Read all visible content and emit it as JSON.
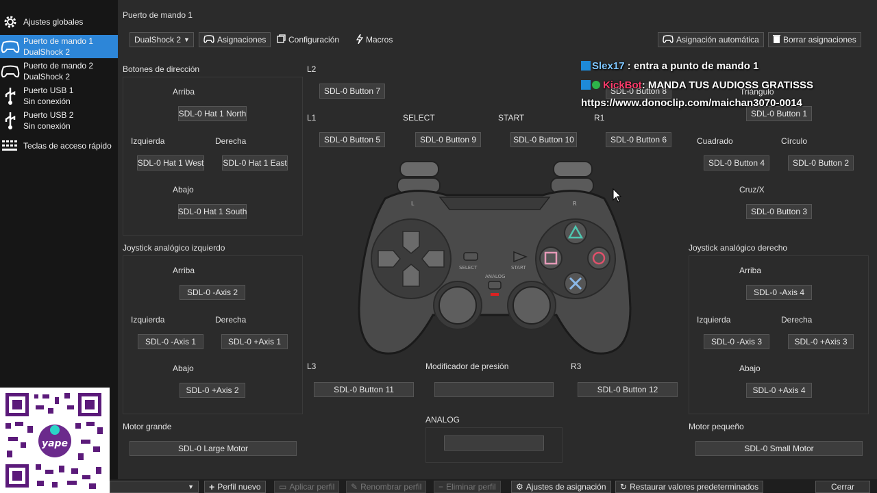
{
  "sidebar": {
    "items": [
      {
        "icon": "gear-icon",
        "line1": "Ajustes globales",
        "line2": ""
      },
      {
        "icon": "gamepad-icon",
        "line1": "Puerto de mando 1",
        "line2": "DualShock 2"
      },
      {
        "icon": "gamepad-icon",
        "line1": "Puerto de mando 2",
        "line2": "DualShock 2"
      },
      {
        "icon": "usb-icon",
        "line1": "Puerto USB 1",
        "line2": "Sin conexión"
      },
      {
        "icon": "usb-icon",
        "line1": "Puerto USB 2",
        "line2": "Sin conexión"
      },
      {
        "icon": "keyboard-icon",
        "line1": "Teclas de acceso rápido",
        "line2": ""
      }
    ]
  },
  "header": {
    "title": "Puerto de mando 1",
    "controller_type": "DualShock 2",
    "tab_bindings": "Asignaciones",
    "tab_settings": "Configuración",
    "tab_macros": "Macros",
    "auto_mapping": "Asignación automática",
    "clear_mapping": "Borrar asignaciones"
  },
  "dpad": {
    "section": "Botones de dirección",
    "up_label": "Arriba",
    "up_value": "SDL-0 Hat 1 North",
    "left_label": "Izquierda",
    "left_value": "SDL-0 Hat 1 West",
    "right_label": "Derecha",
    "right_value": "SDL-0 Hat 1 East",
    "down_label": "Abajo",
    "down_value": "SDL-0 Hat 1 South"
  },
  "left_stick": {
    "section": "Joystick analógico izquierdo",
    "up_label": "Arriba",
    "up_value": "SDL-0 -Axis 2",
    "left_label": "Izquierda",
    "left_value": "SDL-0 -Axis 1",
    "right_label": "Derecha",
    "right_value": "SDL-0 +Axis 1",
    "down_label": "Abajo",
    "down_value": "SDL-0 +Axis 2"
  },
  "center": {
    "l2_label": "L2",
    "l2_value": "SDL-0 Button 7",
    "l1_label": "L1",
    "l1_value": "SDL-0 Button 5",
    "select_label": "SELECT",
    "select_value": "SDL-0 Button 9",
    "start_label": "START",
    "start_value": "SDL-0 Button 10",
    "r1_label": "R1",
    "r1_value": "SDL-0 Button 6",
    "l3_label": "L3",
    "l3_value": "SDL-0 Button 11",
    "pressure_label": "Modificador de presión",
    "pressure_value": "",
    "r3_label": "R3",
    "r3_value": "SDL-0 Button 12",
    "analog_label": "ANALOG",
    "analog_value": ""
  },
  "controller_image": {
    "select_text": "SELECT",
    "start_text": "START",
    "analog_text": "ANALOG",
    "l_text": "L",
    "r_text": "R"
  },
  "face_buttons": {
    "r2_value": "SDL-0 Button 8",
    "triangle_label": "Triángulo",
    "triangle_value": "SDL-0 Button 1",
    "square_label": "Cuadrado",
    "square_value": "SDL-0 Button 4",
    "circle_label": "Círculo",
    "circle_value": "SDL-0 Button 2",
    "cross_label": "Cruz/X",
    "cross_value": "SDL-0 Button 3"
  },
  "right_stick": {
    "section": "Joystick analógico derecho",
    "up_label": "Arriba",
    "up_value": "SDL-0 -Axis 4",
    "left_label": "Izquierda",
    "left_value": "SDL-0 -Axis 3",
    "right_label": "Derecha",
    "right_value": "SDL-0 +Axis 3",
    "down_label": "Abajo",
    "down_value": "SDL-0 +Axis 4"
  },
  "motors": {
    "large_label": "Motor grande",
    "large_value": "SDL-0 Large Motor",
    "small_label": "Motor pequeño",
    "small_value": "SDL-0 Small Motor"
  },
  "bottom": {
    "new_profile": "Perfil nuevo",
    "apply_profile": "Aplicar perfil",
    "rename_profile": "Renombrar perfil",
    "delete_profile": "Eliminar perfil",
    "mapping_settings": "Ajustes de asignación",
    "restore_defaults": "Restaurar valores predeterminados",
    "close": "Cerrar"
  },
  "overlay": {
    "msg1_user": "Slex17",
    "msg1_text": " : entra a punto de mando 1",
    "msg2_user": "KickBot",
    "msg2_text": ": MANDA TUS AUDIOSS GRATISSS",
    "msg3_text": "https://www.donoclip.com/maichan3070-0014",
    "qr_brand": "yape"
  }
}
